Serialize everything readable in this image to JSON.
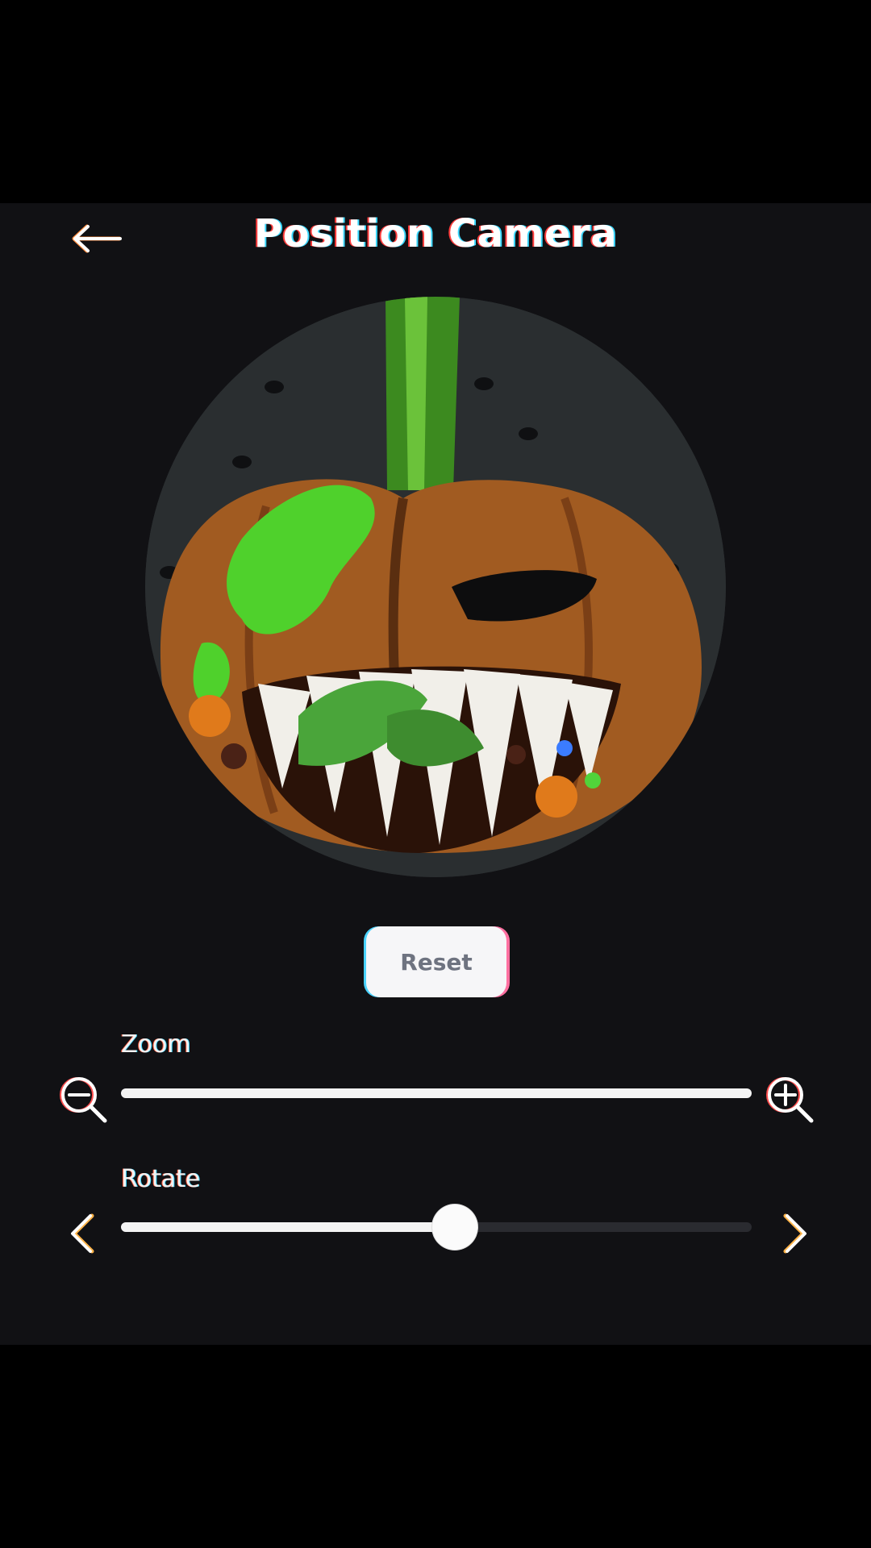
{
  "header": {
    "title": "Position Camera",
    "back_icon": "arrow-left-icon"
  },
  "preview": {
    "subject": "pumpkin-head-avatar"
  },
  "actions": {
    "reset_label": "Reset"
  },
  "zoom": {
    "label": "Zoom",
    "value_fraction": 1.0,
    "decrease_icon": "zoom-out-icon",
    "increase_icon": "zoom-in-icon"
  },
  "rotate": {
    "label": "Rotate",
    "value_fraction": 0.53,
    "decrease_icon": "chevron-left-icon",
    "increase_icon": "chevron-right-icon"
  },
  "colors": {
    "panel": "#111114",
    "accent": "#f4f4f4",
    "preview_bg": "#2a2e30"
  }
}
